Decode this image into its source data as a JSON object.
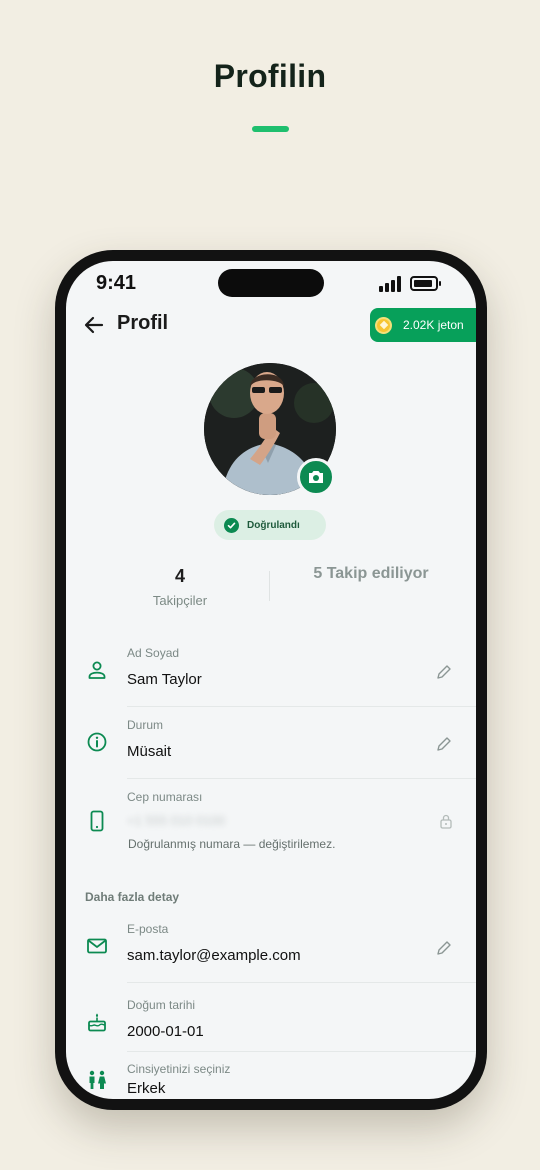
{
  "hero": {
    "title": "Profilin"
  },
  "status_bar": {
    "time": "9:41"
  },
  "header": {
    "title": "Profil",
    "coins": "2.02K jeton"
  },
  "verified_label": "Doğrulandı",
  "stats": {
    "followers_count": "4",
    "followers_label": "Takipçiler",
    "following": "5 Takip ediliyor"
  },
  "fields": {
    "name_label": "Ad Soyad",
    "name_value": "Sam Taylor",
    "status_label": "Durum",
    "status_value": "Müsait",
    "phone_label": "Cep numarası",
    "phone_value": "+1 555 010 0100",
    "phone_note": "Doğrulanmış numara — değiştirilemez."
  },
  "more": {
    "section_title": "Daha fazla detay",
    "email_label": "E-posta",
    "email_value": "sam.taylor@example.com",
    "birth_label": "Doğum tarihi",
    "birth_value": "2000-01-01",
    "gender_label": "Cinsiyetinizi seçiniz",
    "gender_value": "Erkek"
  },
  "colors": {
    "accent": "#07a05a",
    "accent_dark": "#0c8a52",
    "hero_underline": "#1fbf6e",
    "background": "#f2eee3"
  },
  "icons": [
    "back-arrow-icon",
    "coin-icon",
    "camera-icon",
    "check-icon",
    "person-icon",
    "info-icon",
    "phone-icon",
    "lock-icon",
    "mail-icon",
    "cake-icon",
    "gender-icon",
    "pencil-icon"
  ]
}
